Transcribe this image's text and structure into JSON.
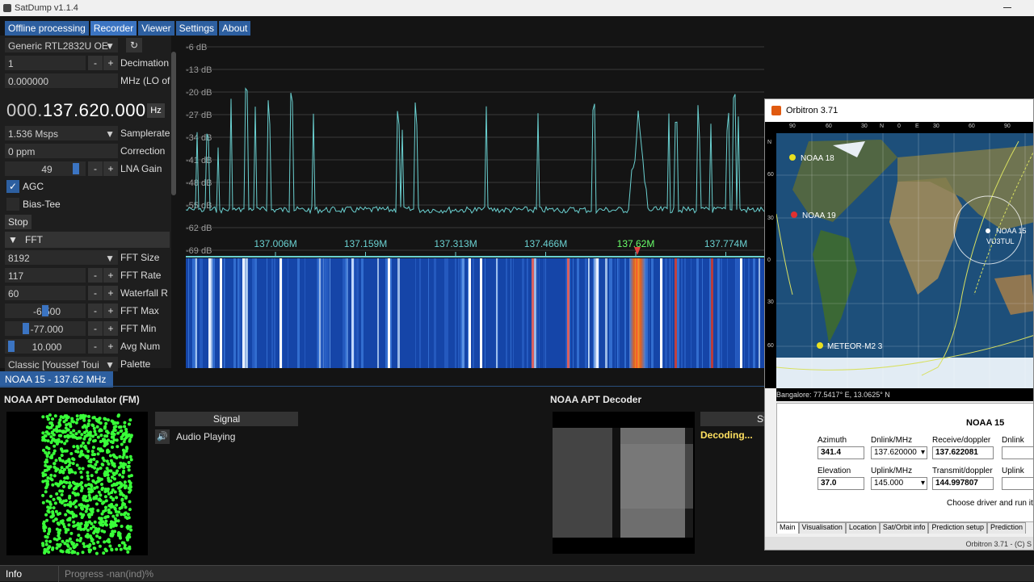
{
  "window": {
    "title": "SatDump v1.1.4"
  },
  "menu": {
    "tabs": [
      {
        "label": "Offline processing"
      },
      {
        "label": "Recorder"
      },
      {
        "label": "Viewer"
      },
      {
        "label": "Settings"
      },
      {
        "label": "About"
      }
    ]
  },
  "source": {
    "device": "Generic RTL2832U OE",
    "decimation_value": "1",
    "decimation_label": "Decimation",
    "lo_offset_value": "0.000000",
    "lo_offset_label": "MHz (LO of",
    "frequency_prefix": "000.",
    "frequency_main": "137.620.000",
    "frequency_unit": "Hz",
    "samplerate_value": "1.536 Msps",
    "samplerate_label": "Samplerate",
    "correction_value": "0 ppm",
    "correction_label": "Correction",
    "lna_gain_value": "49",
    "lna_gain_label": "LNA Gain",
    "agc_label": "AGC",
    "agc_checked": true,
    "bias_tee_label": "Bias-Tee",
    "stop_label": "Stop"
  },
  "fft": {
    "section_label": "FFT",
    "fft_size_value": "8192",
    "fft_size_label": "FFT Size",
    "fft_rate_value": "117",
    "fft_rate_label": "FFT Rate",
    "waterfall_rate_value": "60",
    "waterfall_rate_label": "Waterfall R",
    "fft_max_value": "-6.500",
    "fft_max_label": "FFT Max",
    "fft_min_value": "-77.000",
    "fft_min_label": "FFT Min",
    "avg_num_value": "10.000",
    "avg_num_label": "Avg Num",
    "palette_value": "Classic [Youssef Toui",
    "palette_label": "Palette"
  },
  "spectrum": {
    "db_labels": [
      "-6 dB",
      "-13 dB",
      "-20 dB",
      "-27 dB",
      "-34 dB",
      "-41 dB",
      "-48 dB",
      "-55 dB",
      "-62 dB",
      "-69 dB"
    ],
    "freq_labels": [
      "137.006M",
      "137.159M",
      "137.313M",
      "137.466M",
      "137.62M",
      "137.774M"
    ]
  },
  "vfo": {
    "label": "NOAA 15 - 137.62 MHz"
  },
  "demod": {
    "title": "NOAA APT Demodulator (FM)",
    "signal_header": "Signal",
    "audio_status": "Audio Playing",
    "audio_icon": "speaker-icon"
  },
  "decoder": {
    "title": "NOAA APT Decoder",
    "button_label": "St",
    "status": "Decoding..."
  },
  "status_bar": {
    "label": "Info",
    "progress": "Progress -nan(ind)%"
  },
  "orbitron": {
    "title": "Orbitron 3.71",
    "top_scale": [
      "90",
      "60",
      "30",
      "N",
      "0",
      "E",
      "30",
      "60",
      "90"
    ],
    "side_scale": [
      "N",
      "60",
      "30",
      "0",
      "30",
      "60"
    ],
    "satellites": [
      {
        "name": "NOAA 18",
        "color": "#e8e020"
      },
      {
        "name": "NOAA 19",
        "color": "#e03030"
      },
      {
        "name": "NOAA 15",
        "color": "#ffffff"
      },
      {
        "name": "VU3TUL",
        "color": "#ffffff"
      },
      {
        "name": "METEOR-M2 3",
        "color": "#e8e020"
      }
    ],
    "location": "Bangalore: 77.5417° E, 13.0625° N",
    "panel_title": "NOAA 15",
    "azimuth_label": "Azimuth",
    "azimuth_value": "341.4",
    "dnlink_label": "Dnlink/MHz",
    "dnlink_value": "137.620000",
    "receive_label": "Receive/doppler",
    "receive_value": "137.622081",
    "dnlink_mode_label": "Dnlink mo",
    "elevation_label": "Elevation",
    "elevation_value": "37.0",
    "uplink_label": "Uplink/MHz",
    "uplink_value": "145.000",
    "transmit_label": "Transmit/doppler",
    "transmit_value": "144.997807",
    "uplink_mode_label": "Uplink mo",
    "driver_hint": "Choose driver and run it",
    "tabs": [
      "Main",
      "Visualisation",
      "Location",
      "Sat/Orbit info",
      "Prediction setup",
      "Prediction"
    ],
    "status": "Orbitron 3.71 - (C) S"
  },
  "colors": {
    "accent": "#2d5fa0",
    "spectrum_line": "#6ad0d0",
    "waterfall_bg": "#1545a8",
    "signal_peak": "#e06020"
  }
}
